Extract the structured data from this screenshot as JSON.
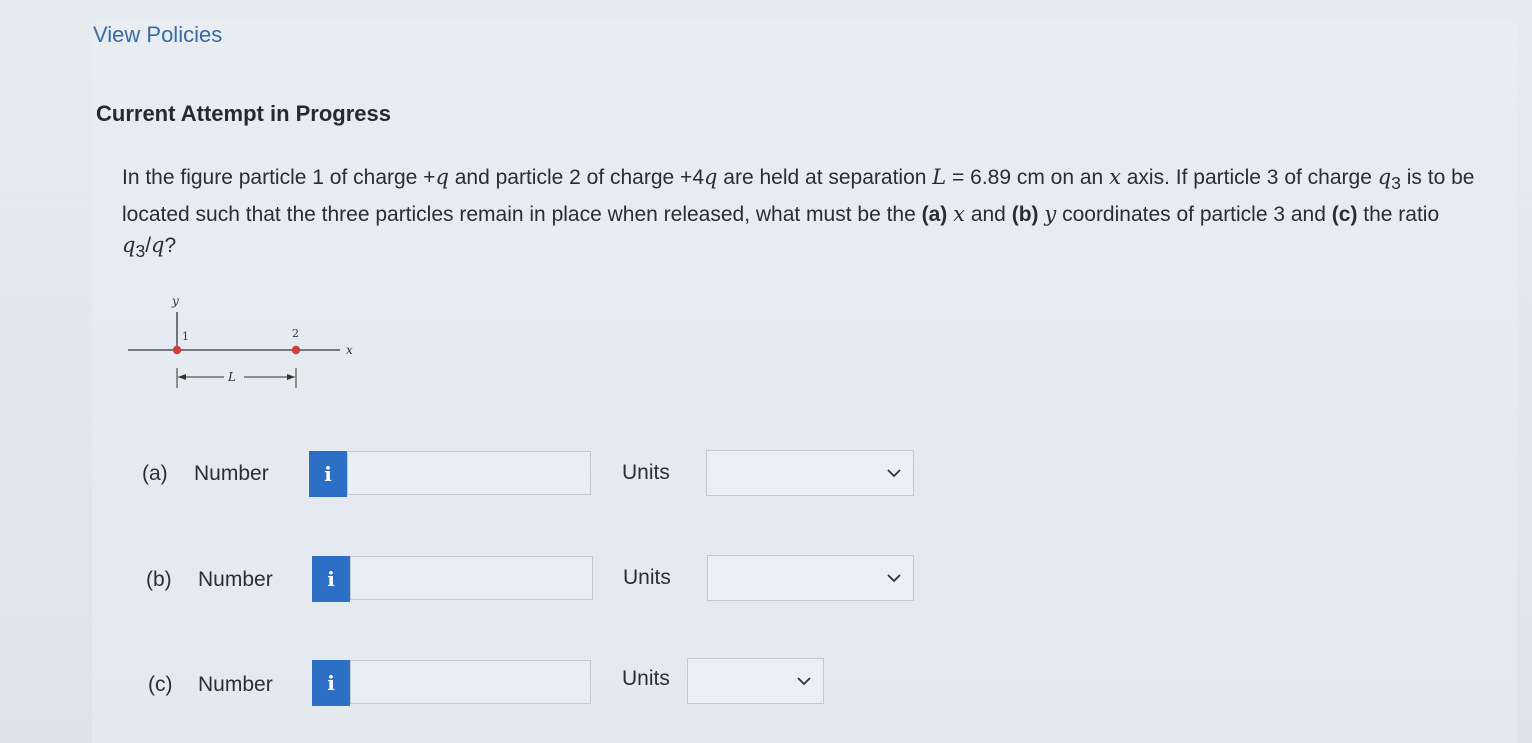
{
  "header": {
    "view_policies": "View Policies",
    "attempt_title": "Current Attempt in Progress"
  },
  "question": {
    "s1": "In the figure particle 1 of charge +",
    "q1": "q",
    "s2": " and particle 2 of charge +4",
    "q2": "q",
    "s3": " are held at separation ",
    "L": "L",
    "s4": " = 6.89 cm on an ",
    "x1": "x",
    "s5": " axis. If particle 3 of charge ",
    "q3": "q",
    "q3sub": "3",
    "s6": " is to be located such that the three particles remain in place when released, what must be the ",
    "a": "(a)",
    "s7": " ",
    "x2": "x",
    "s8": " and ",
    "b": "(b)",
    "s9": " ",
    "y1": "y",
    "s10": " coordinates of particle 3 and ",
    "c": "(c)",
    "s11": " the ratio ",
    "r_q3": "q",
    "r_q3sub": "3",
    "r_slash": "/",
    "r_q": "q",
    "s12": "?"
  },
  "figure": {
    "y_axis_label": "y",
    "x_axis_label": "x",
    "particle1_label": "1",
    "particle2_label": "2",
    "separation_label": "L",
    "particle_color": "#d23c3c"
  },
  "parts": [
    {
      "label": "(a)",
      "number_label": "Number",
      "info": "i",
      "value": "",
      "units_label": "Units",
      "units_value": ""
    },
    {
      "label": "(b)",
      "number_label": "Number",
      "info": "i",
      "value": "",
      "units_label": "Units",
      "units_value": ""
    },
    {
      "label": "(c)",
      "number_label": "Number",
      "info": "i",
      "value": "",
      "units_label": "Units",
      "units_value": ""
    }
  ],
  "colors": {
    "link": "#3b6aa0",
    "info_button": "#2d6fc4"
  }
}
